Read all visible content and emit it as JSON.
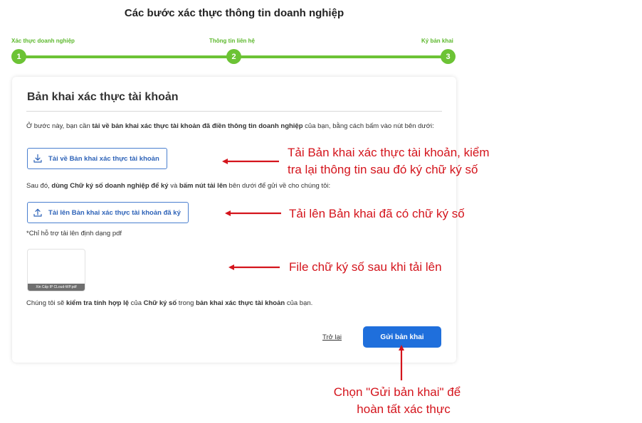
{
  "page_title": "Các bước xác thực thông tin doanh nghiệp",
  "steps": [
    {
      "label": "Xác thực doanh nghiệp",
      "number": "1"
    },
    {
      "label": "Thông tin liên hệ",
      "number": "2"
    },
    {
      "label": "Ký bản khai",
      "number": "3"
    }
  ],
  "card": {
    "title": "Bản khai xác thực tài khoản",
    "intro": {
      "p1": "Ở bước này, bạn cần ",
      "b1": "tải về bản khai xác thực tài khoản đã điền thông tin doanh nghiệp",
      "p2": " của bạn, bằng cách bấm vào nút bên dưới:"
    },
    "download_button": "Tải về Bản khai xác thực tài khoản",
    "instruction": {
      "p1": "Sau đó, ",
      "b1": "dùng Chữ ký số doanh nghiệp để ký",
      "p2": " và ",
      "b2": "bấm nút tải lên",
      "p3": " bên dưới để gửi về cho chúng tôi:"
    },
    "upload_button": "Tải lên Bản khai xác thực tài khoản đã ký",
    "pdf_note": "*Chỉ hỗ trợ tải lên định dạng pdf",
    "file_name": "Xin Cấp IP CLoud-WP.pdf",
    "validation": {
      "p1": "Chúng tôi sẽ ",
      "b1": "kiểm tra tính hợp lệ",
      "p2": " của ",
      "b2": "Chữ ký số",
      "p3": " trong ",
      "b3": "bản khai xác thực tài khoản",
      "p4": " của bạn."
    },
    "back_link": "Trở lại",
    "submit_button": "Gửi bản khai"
  },
  "annotations": {
    "download_line1": "Tải Bản khai xác thực tài khoản, kiểm",
    "download_line2": "tra lại thông tin sau đó ký chữ ký số",
    "upload": "Tải lên Bản khai đã có chữ ký số",
    "file": "File chữ ký số sau khi tải lên",
    "submit_line1": "Chọn \"Gửi bản khai\" để",
    "submit_line2": "hoàn tất xác thực"
  },
  "colors": {
    "stepper_green": "#6cc335",
    "primary_blue": "#1f6fdc",
    "annotation_red": "#d4141c"
  }
}
